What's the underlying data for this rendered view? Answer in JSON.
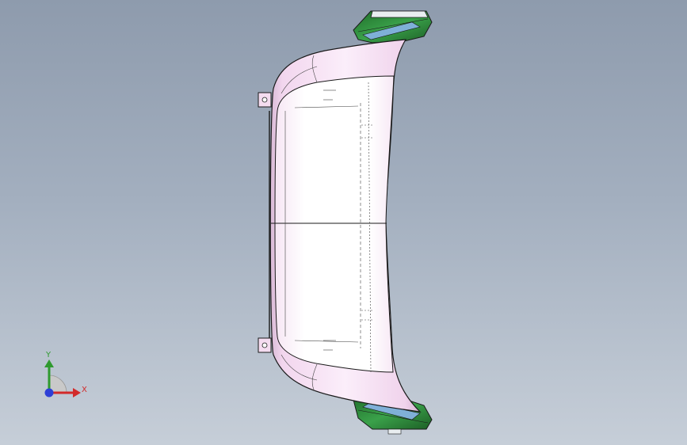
{
  "viewport": {
    "background_top": "#8e9bad",
    "background_bottom": "#c6ced8"
  },
  "model": {
    "body_color": "#f4dcf0",
    "face_color": "#ffffff",
    "edge_color": "#2a2a2a",
    "bracket_color": "#2f8f3a",
    "bracket_glass_color": "#7fb0d8"
  },
  "triad": {
    "y_label": "Y",
    "x_label": "X",
    "y_color": "#2f9a2f",
    "x_color": "#d22a2a",
    "z_color": "#2d3fd6"
  }
}
